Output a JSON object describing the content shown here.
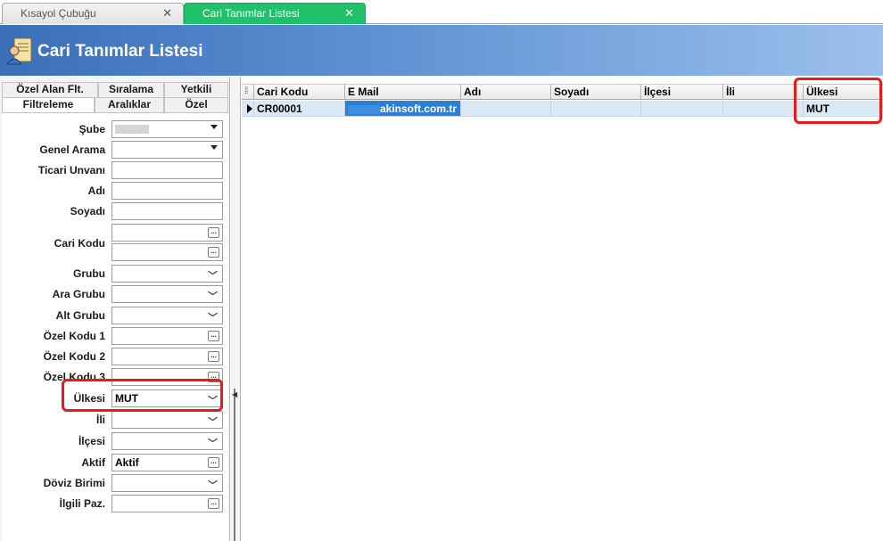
{
  "tabs": [
    {
      "label": "Kısayol Çubuğu",
      "active": false
    },
    {
      "label": "Cari Tanımlar Listesi",
      "active": true
    }
  ],
  "header": {
    "title": "Cari Tanımlar Listesi",
    "icon": "contacts-list-icon"
  },
  "panel_tabs": {
    "row1": [
      "Özel Alan Flt.",
      "Sıralama",
      "Yetkili"
    ],
    "row2": [
      "Filtreleme",
      "Aralıklar",
      "Özel"
    ],
    "active": "Filtreleme"
  },
  "filters": {
    "sube": {
      "label": "Şube",
      "value": ""
    },
    "genel_arama": {
      "label": "Genel Arama",
      "value": ""
    },
    "ticari_unvani": {
      "label": "Ticari Unvanı",
      "value": ""
    },
    "adi": {
      "label": "Adı",
      "value": ""
    },
    "soyadi": {
      "label": "Soyadı",
      "value": ""
    },
    "cari_kodu": {
      "label": "Cari Kodu",
      "value_from": "",
      "value_to": ""
    },
    "grubu": {
      "label": "Grubu",
      "value": ""
    },
    "ara_grubu": {
      "label": "Ara Grubu",
      "value": ""
    },
    "alt_grubu": {
      "label": "Alt Grubu",
      "value": ""
    },
    "ozel_kodu_1": {
      "label": "Özel Kodu 1",
      "value": ""
    },
    "ozel_kodu_2": {
      "label": "Özel Kodu 2",
      "value": ""
    },
    "ozel_kodu_3": {
      "label": "Özel Kodu 3",
      "value": ""
    },
    "ulkesi": {
      "label": "Ülkesi",
      "value": "MUT"
    },
    "ili": {
      "label": "İli",
      "value": ""
    },
    "ilcesi": {
      "label": "İlçesi",
      "value": ""
    },
    "aktif": {
      "label": "Aktif",
      "value": "Aktif"
    },
    "doviz_birimi": {
      "label": "Döviz Birimi",
      "value": ""
    },
    "ilgili_paz": {
      "label": "İlgili Paz.",
      "value": ""
    }
  },
  "grid": {
    "columns": [
      "Cari Kodu",
      "E Mail",
      "Adı",
      "Soyadı",
      "İlçesi",
      "İli",
      "Ülkesi"
    ],
    "rows": [
      {
        "cari_kodu": "CR00001",
        "email": "akinsoft.com.tr",
        "adi": "",
        "soyadi": "",
        "ilcesi": "",
        "ili": "",
        "ulkesi": "MUT"
      }
    ]
  },
  "colors": {
    "active_tab": "#1fc16a",
    "header_start": "#3a6fb8",
    "highlight": "#e81a1a",
    "selected_cell": "#2b7fd4"
  }
}
